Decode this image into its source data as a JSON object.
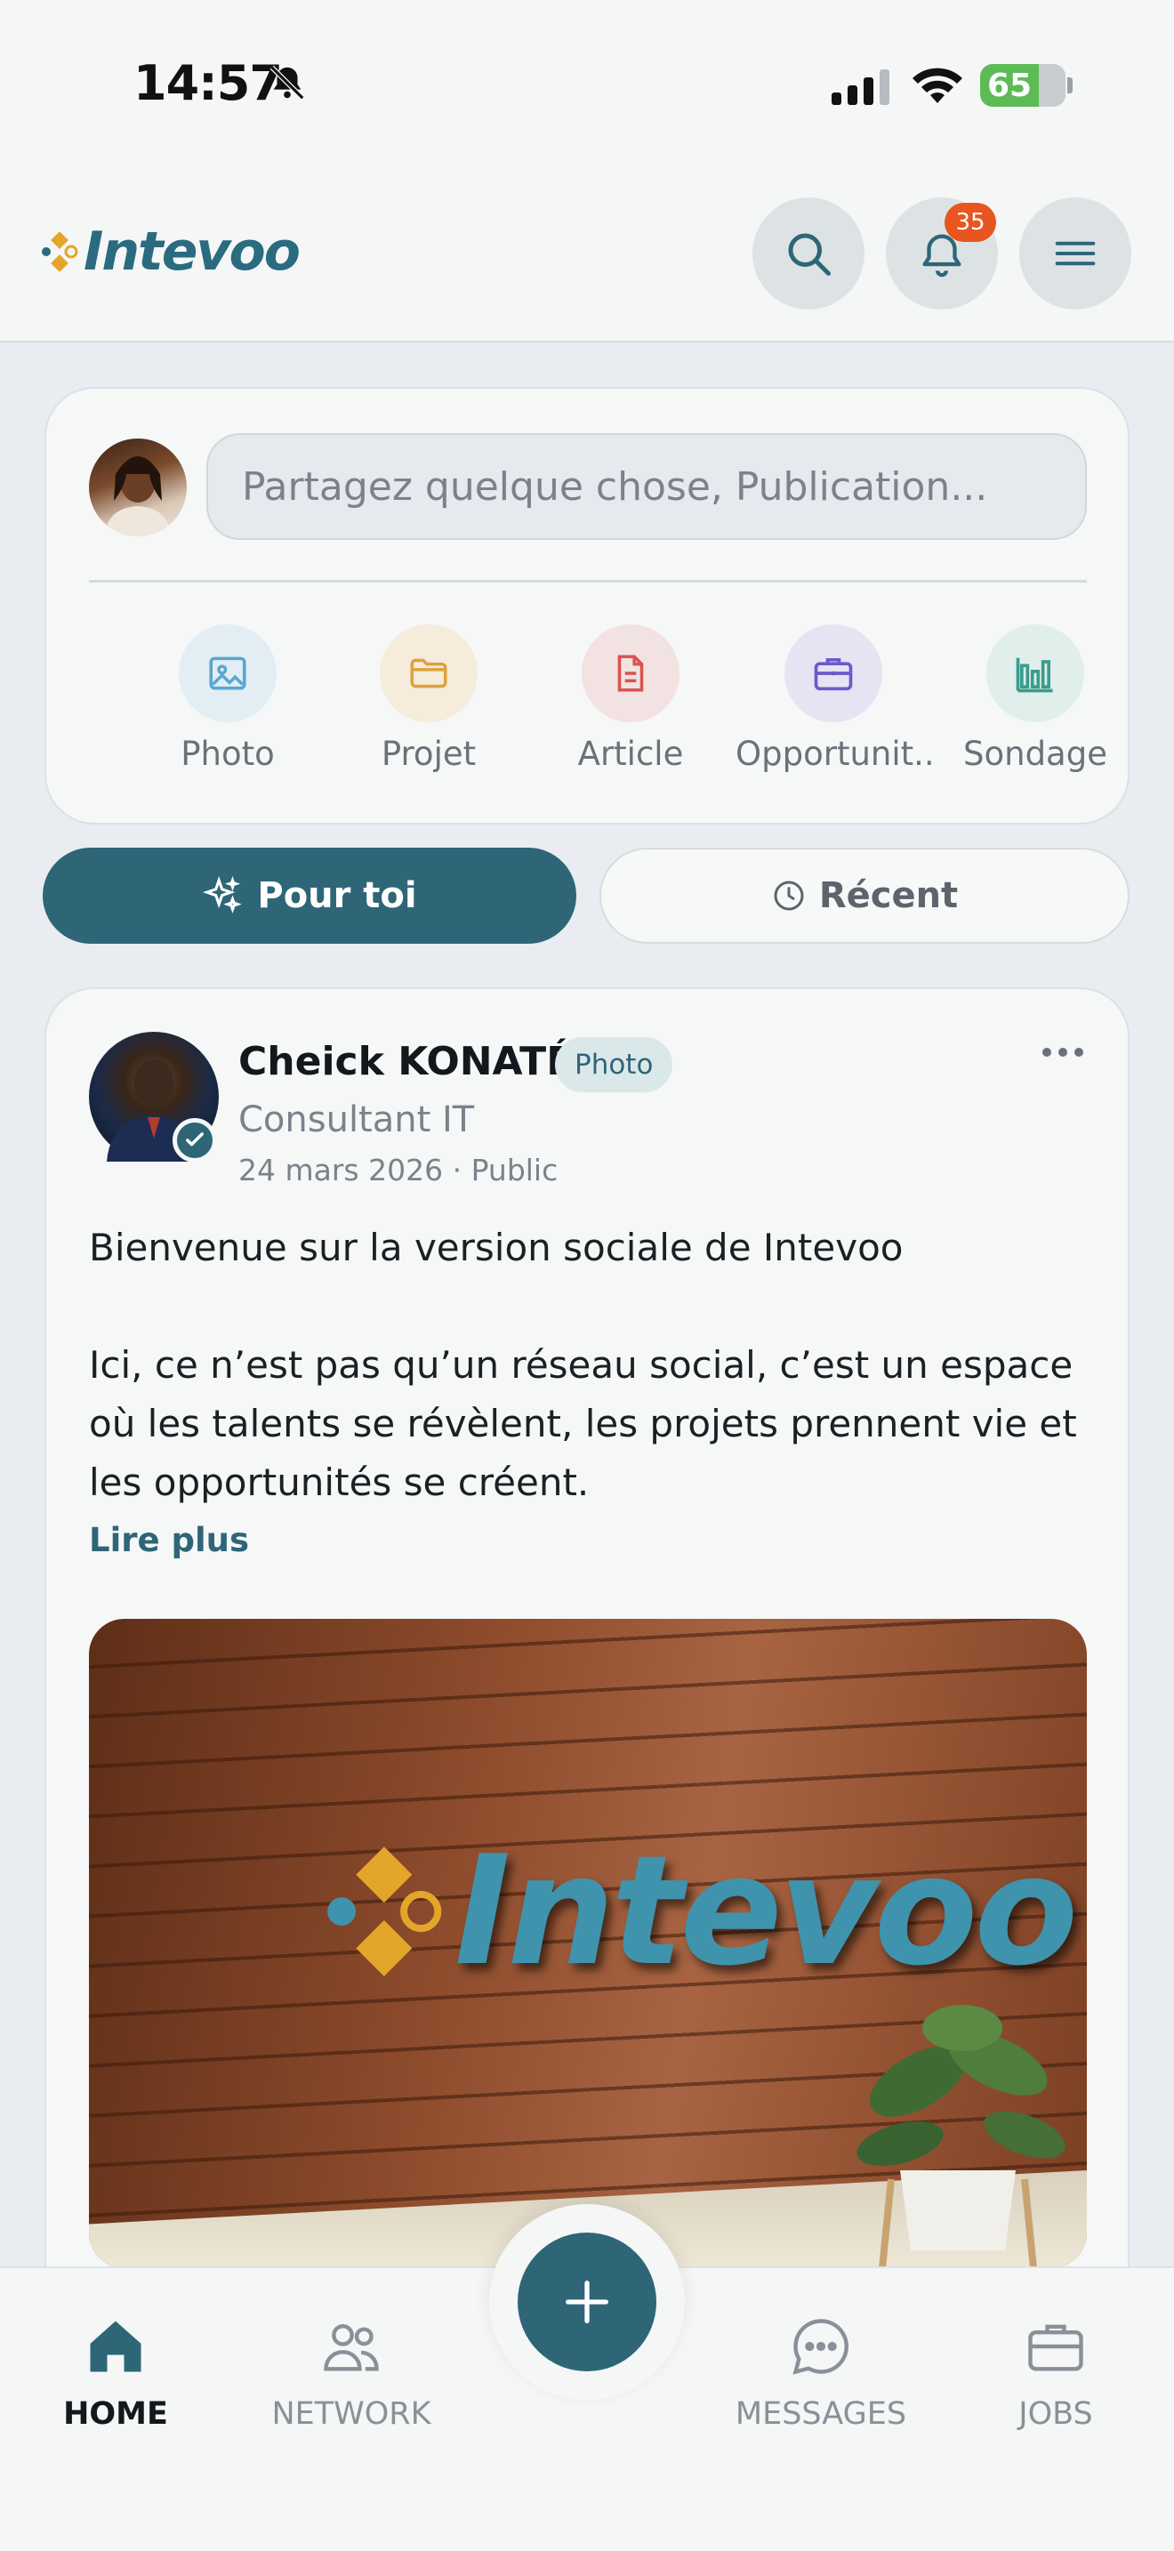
{
  "status_bar": {
    "time": "14:57",
    "battery": "65"
  },
  "header": {
    "logo_text": "Intevoo",
    "notifications_count": "35"
  },
  "composer": {
    "placeholder": "Partagez quelque chose, Publication...",
    "actions": [
      {
        "label": "Photo",
        "icon": "image-icon",
        "color": "#5aa6d0"
      },
      {
        "label": "Projet",
        "icon": "folder-icon",
        "color": "#e0a03c"
      },
      {
        "label": "Article",
        "icon": "document-icon",
        "color": "#d9534f"
      },
      {
        "label": "Opportunit...",
        "icon": "briefcase-icon",
        "color": "#6a5acd"
      },
      {
        "label": "Sondage",
        "icon": "bar-chart-icon",
        "color": "#3a9c8c"
      }
    ]
  },
  "feed_tabs": {
    "for_you": "Pour toi",
    "recent": "Récent"
  },
  "post": {
    "author": "Cheick KONATÉ",
    "tag": "Photo",
    "role": "Consultant IT",
    "date": "24 mars 2026",
    "visibility": "Public",
    "paragraphs": [
      "Bienvenue sur la version sociale de Intevoo",
      "Ici, ce n’est pas qu’un réseau social, c’est un espace où les talents se révèlent, les projets prennent vie et les opportunités se créent."
    ],
    "read_more": "Lire plus",
    "image_text": "Intevoo"
  },
  "bottom_nav": {
    "home": "HOME",
    "network": "NETWORK",
    "messages": "MESSAGES",
    "jobs": "JOBS"
  },
  "colors": {
    "primary": "#2e6678",
    "badge": "#e8551f",
    "logo_gold": "#e3a62b"
  }
}
